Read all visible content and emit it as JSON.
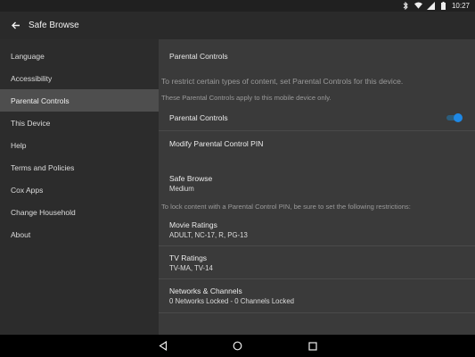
{
  "status_bar": {
    "time": "10:27",
    "icons": [
      "bluetooth-icon",
      "wifi-icon",
      "signal-icon",
      "battery-icon"
    ]
  },
  "app_bar": {
    "back_icon": "arrow-left-icon",
    "title": "Safe Browse"
  },
  "sidebar": {
    "items": [
      {
        "label": "Language"
      },
      {
        "label": "Accessibility"
      },
      {
        "label": "Parental Controls",
        "active": true
      },
      {
        "label": "This Device"
      },
      {
        "label": "Help"
      },
      {
        "label": "Terms and Policies"
      },
      {
        "label": "Cox Apps"
      },
      {
        "label": "Change Household"
      },
      {
        "label": "About"
      }
    ]
  },
  "main": {
    "section_title": "Parental Controls",
    "intro": "To restrict certain types of content, set Parental Controls for this device.",
    "device_note": "These Parental Controls apply to this mobile device only.",
    "parental_toggle": {
      "label": "Parental Controls",
      "enabled": true
    },
    "modify_pin": {
      "label": "Modify Parental Control PIN"
    },
    "safe_browse": {
      "label": "Safe Browse",
      "value": "Medium"
    },
    "lock_note": "To lock content with a Parental Control PIN, be sure to set the following restrictions:",
    "movie_ratings": {
      "label": "Movie Ratings",
      "value": "ADULT, NC-17, R, PG-13"
    },
    "tv_ratings": {
      "label": "TV Ratings",
      "value": "TV-MA, TV-14"
    },
    "networks": {
      "label": "Networks & Channels",
      "value": "0 Networks Locked - 0 Channels Locked"
    }
  },
  "nav_bar": {
    "icons": [
      "back-triangle-icon",
      "home-circle-icon",
      "recents-square-icon"
    ]
  },
  "colors": {
    "accent": "#1e88e5",
    "sidebar_bg": "#2c2c2c",
    "main_bg": "#3a3a3a",
    "active_item_bg": "#4e4e4e"
  }
}
